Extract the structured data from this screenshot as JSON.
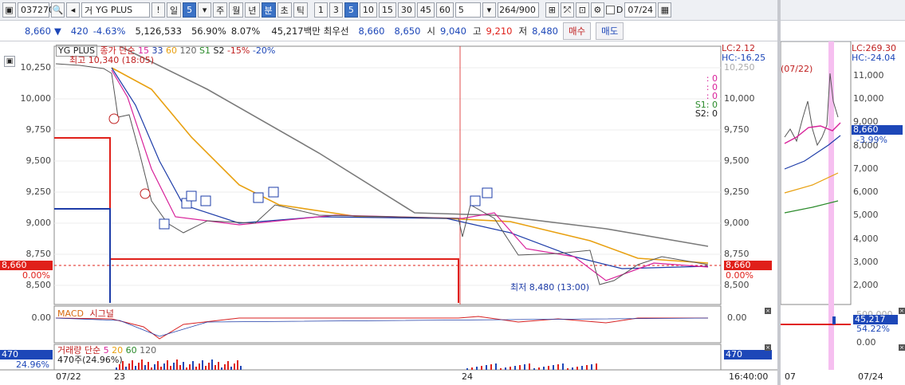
{
  "toolbar": {
    "code": "037270",
    "search_icon": "magnifier-icon",
    "prev_icon": "prev-arrow-icon",
    "market_label": "거",
    "stock_name": "YG PLUS",
    "warning_label": "!",
    "period_day": "일",
    "period_value": "5",
    "tabs": [
      "주",
      "월",
      "년",
      "분",
      "초",
      "틱"
    ],
    "active_tab": "분",
    "intervals": [
      "1",
      "3",
      "5",
      "10",
      "15",
      "30",
      "45",
      "60"
    ],
    "active_interval": "5",
    "count_value": "5",
    "range_display": "264/900",
    "date_checkbox_label": "D",
    "date_value": "07/24"
  },
  "quote": {
    "price": "8,660",
    "change_arrow": "▼",
    "change": "420",
    "change_pct": "-4.63%",
    "volume": "5,126,533",
    "turnover": "56.90%",
    "vol_pct": "8.07%",
    "amount": "45,217백만",
    "best_label": "최우선",
    "ask": "8,660",
    "bid": "8,650",
    "open_label": "시",
    "open": "9,040",
    "high_label": "고",
    "high": "9,210",
    "low_label": "저",
    "low": "8,480",
    "buy_btn": "매수",
    "sell_btn": "매도"
  },
  "main_chart": {
    "title": "YG PLUS",
    "legend": [
      "종가 단순",
      "15",
      "33",
      "60",
      "120",
      "S1",
      "S2",
      "-15%",
      "-20%"
    ],
    "high_note": "최고 10,340 (18:05)",
    "low_note": "최저 8,480 (13:00)",
    "lc_text": "LC:2.12",
    "hc_text": "HC:-16.25",
    "signal_lines": [
      ": 0",
      ": 0",
      ": 0",
      "S1: 0",
      "S2: 0"
    ],
    "price_badge": "8,660",
    "pct_badge": "0.00%",
    "y_ticks": [
      "10,250",
      "10,000",
      "9,750",
      "9,500",
      "9,250",
      "9,000",
      "8,750",
      "8,500"
    ]
  },
  "macd_panel": {
    "title": "MACD",
    "signal_label": "시그널",
    "zero_label": "0.00"
  },
  "volume_panel": {
    "title": "거래량",
    "legend": [
      "단순",
      "5",
      "20",
      "60",
      "120"
    ],
    "value_text": "470주(24.96%)",
    "value_badge": "470",
    "pct_badge": "24.96%"
  },
  "x_axis": {
    "labels": [
      "07/22",
      "23",
      "24"
    ],
    "time_label": "16:40:00"
  },
  "right_panel": {
    "date_note": "(07/22)",
    "lc_text": "LC:269.30",
    "hc_text": "HC:-24.04",
    "y_ticks": [
      "11,000",
      "10,000",
      "9,000",
      "8,000",
      "7,000",
      "6,000",
      "5,000",
      "4,000",
      "3,000",
      "2,000"
    ],
    "price_badge": "8,660",
    "pct_text": "-3.99%",
    "vol_ticks": [
      "500,000",
      "0.00"
    ],
    "vol_badge": "45,217",
    "vol_pct": "54.22%",
    "x_labels": [
      "07",
      "07/24"
    ]
  },
  "colors": {
    "up": "#e0201a",
    "down": "#1d47b8",
    "ma5": "#d8229a",
    "ma20": "#e8a010",
    "ma60": "#1d3ca8",
    "ma120": "#7a7a7a",
    "highlight": "#f6bff0"
  }
}
